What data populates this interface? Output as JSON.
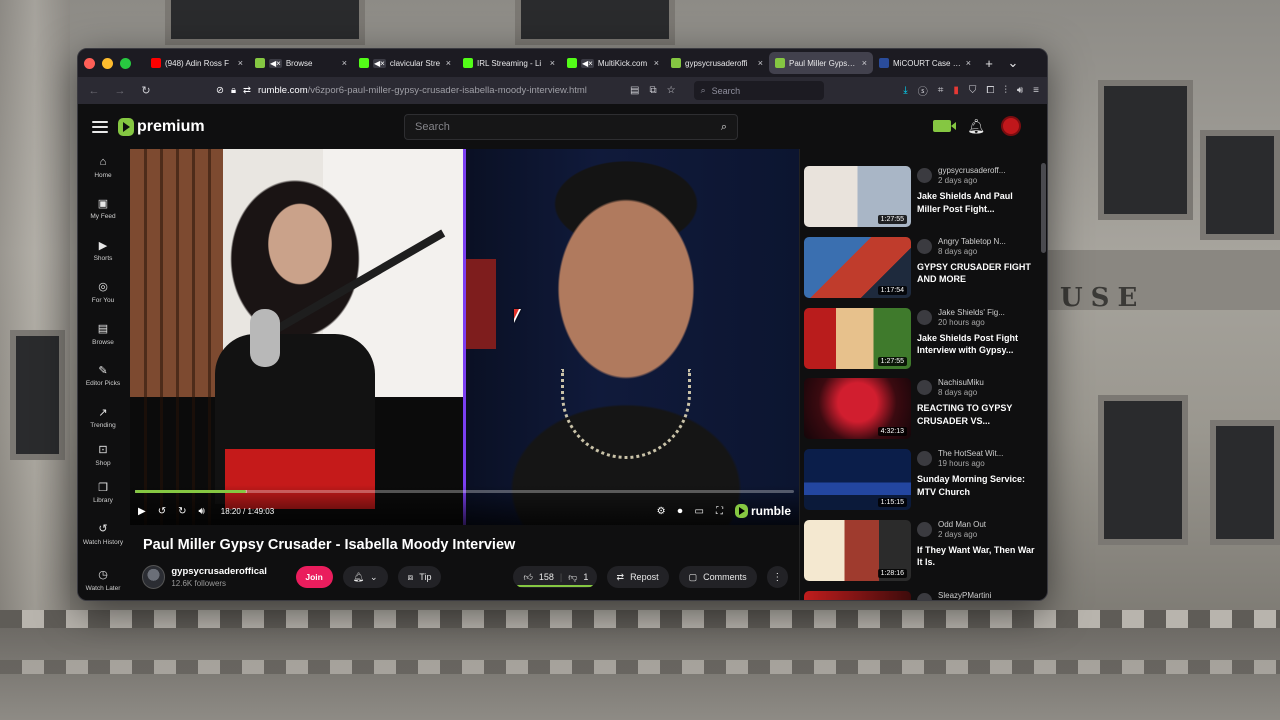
{
  "browser": {
    "tabs": [
      {
        "title": "(948) Adin Ross F",
        "fav_color": "#ff0000",
        "muted": false,
        "active": false
      },
      {
        "title": "Browse",
        "fav_color": "#85c742",
        "muted": true,
        "active": false
      },
      {
        "title": "clavicular Stre",
        "fav_color": "#53fc18",
        "muted": true,
        "active": false
      },
      {
        "title": "IRL Streaming - Li",
        "fav_color": "#53fc18",
        "muted": false,
        "active": false
      },
      {
        "title": "MultiKick.com",
        "fav_color": "#53fc18",
        "muted": true,
        "active": false
      },
      {
        "title": "gypsycrusaderoffi",
        "fav_color": "#85c742",
        "muted": false,
        "active": false
      },
      {
        "title": "Paul Miller Gypsy C",
        "fav_color": "#85c742",
        "muted": false,
        "active": true
      },
      {
        "title": "MiCOURT Case Se",
        "fav_color": "#2a4c9b",
        "muted": false,
        "active": false
      }
    ],
    "url_host": "rumble.com",
    "url_path": "/v6zpor6-paul-miller-gypsy-crusader-isabella-moody-interview.html",
    "search_placeholder": "Search"
  },
  "rumble": {
    "logo_text": "premium",
    "search_placeholder": "Search",
    "sidebar": [
      {
        "label": "Home",
        "icon": "home-icon",
        "glyph": "⌂"
      },
      {
        "label": "My Feed",
        "icon": "feed-icon",
        "glyph": "▣"
      },
      {
        "label": "Shorts",
        "icon": "shorts-icon",
        "glyph": "▶"
      },
      {
        "label": "For You",
        "icon": "for-you-icon",
        "glyph": "◎"
      },
      {
        "label": "Browse",
        "icon": "browse-icon",
        "glyph": "▤"
      },
      {
        "label": "Editor Picks",
        "icon": "editor-picks-icon",
        "glyph": "✎"
      },
      {
        "label": "Trending",
        "icon": "trending-icon",
        "glyph": "↗"
      },
      {
        "label": "Shop",
        "icon": "shop-icon",
        "glyph": "⊡"
      },
      {
        "label": "Library",
        "icon": "library-icon",
        "glyph": "❐"
      },
      {
        "label": "Watch History",
        "icon": "history-icon",
        "glyph": "↺"
      },
      {
        "label": "Watch Later",
        "icon": "clock-icon",
        "glyph": "◷"
      }
    ],
    "player": {
      "time_text": "18:20 / 1:49:03",
      "progress": 0.168,
      "watermark": "rumble"
    },
    "video": {
      "title": "Paul Miller Gypsy Crusader - Isabella Moody Interview",
      "channel": "gypsycrusaderoffical",
      "followers": "12.6K followers",
      "join_label": "Join",
      "tip_label": "Tip",
      "likes": "158",
      "dislikes": "1",
      "repost_label": "Repost",
      "comments_label": "Comments"
    },
    "recommended": [
      {
        "channel": "gypsycrusaderoff...",
        "age": "2 days ago",
        "title": "Jake Shields And Paul Miller Post Fight...",
        "duration": "1:27:55",
        "thumb_bg": "linear-gradient(90deg,#e9e3dc 0 50%,#a9b6c6 50%)"
      },
      {
        "channel": "Angry Tabletop N...",
        "age": "8 days ago",
        "title": "GYPSY CRUSADER FIGHT AND MORE",
        "duration": "1:17:54",
        "thumb_bg": "linear-gradient(135deg,#3a6fb0 0 40%,#c03c2c 40% 70%,#1e2a3d 70%)"
      },
      {
        "channel": "Jake Shields' Fig...",
        "age": "20 hours ago",
        "title": "Jake Shields Post Fight Interview with Gypsy...",
        "duration": "1:27:55",
        "thumb_bg": "linear-gradient(90deg,#b91c1c 0 30%,#e7c18c 30% 65%,#3f7a2c 65%)"
      },
      {
        "channel": "NachisuMiku",
        "age": "8 days ago",
        "title": "REACTING TO GYPSY CRUSADER VS...",
        "duration": "4:32:13",
        "thumb_bg": "radial-gradient(circle at 50% 40%,#d11e2f 0 30%,#3b0a10 60%,#140509)"
      },
      {
        "channel": "The HotSeat Wit...",
        "age": "19 hours ago",
        "title": "Sunday Morning Service: MTV Church",
        "duration": "1:15:15",
        "thumb_bg": "linear-gradient(180deg,#0b1e4a 0 55%,#2346a0 55% 75%,#0b1a3a 75%)"
      },
      {
        "channel": "Odd Man Out",
        "age": "2 days ago",
        "title": "If They Want War, Then War It Is.",
        "duration": "1:28:16",
        "thumb_bg": "linear-gradient(90deg,#f4e8d0 0 38%,#9f3b2e 38% 70%,#2b2b2b 70%)"
      },
      {
        "channel": "SleazyPMartini",
        "age": "",
        "title": "",
        "duration": "",
        "thumb_bg": "linear-gradient(90deg,#c01d1d,#3d0b0b)"
      }
    ]
  }
}
